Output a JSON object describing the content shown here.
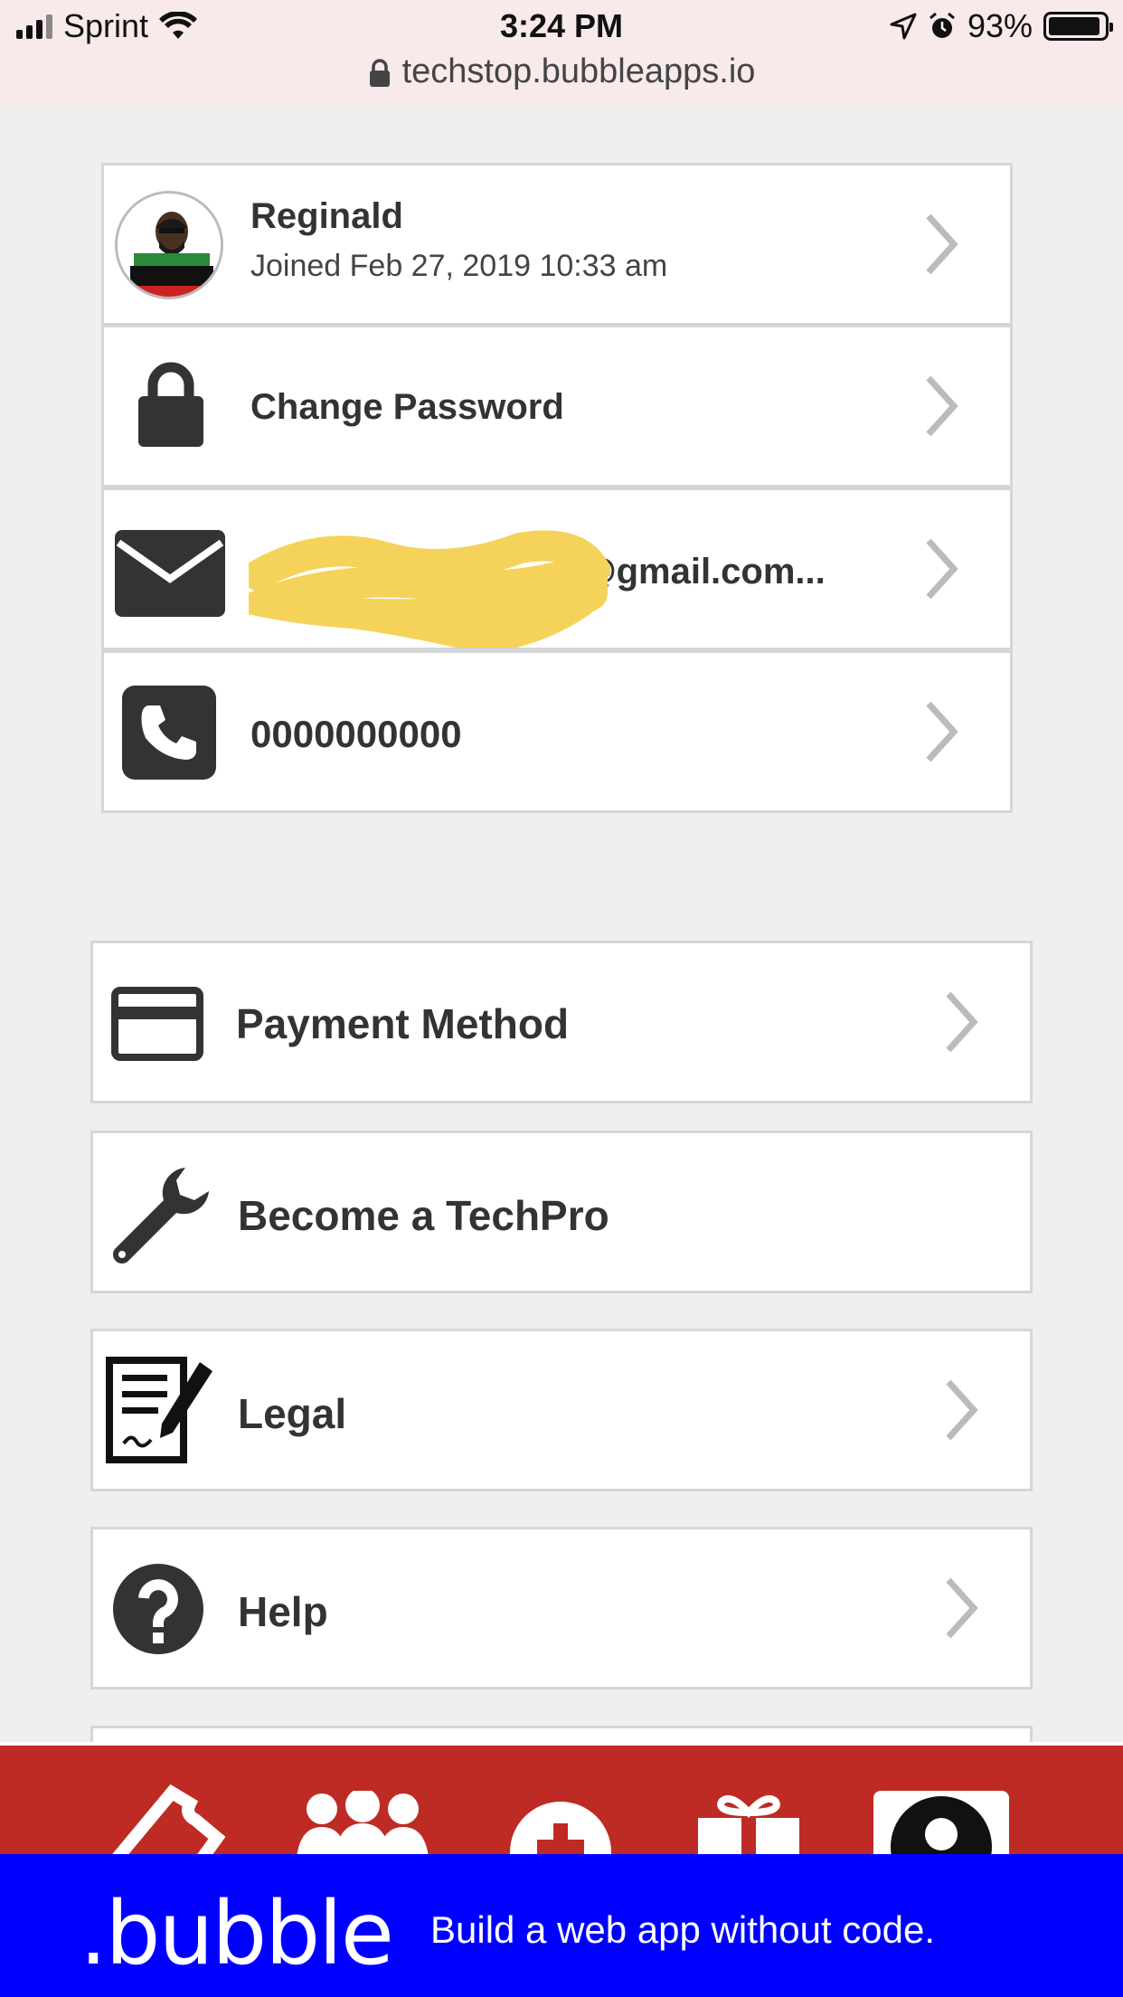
{
  "status": {
    "carrier": "Sprint",
    "time": "3:24 PM",
    "battery": "93%",
    "battery_level": 0.93,
    "url": "techstop.bubbleapps.io"
  },
  "profile": {
    "name": "Reginald",
    "joined": "Joined Feb 27, 2019 10:33 am"
  },
  "account": {
    "change_password": "Change Password",
    "email": "@gmail.com...",
    "phone": "0000000000"
  },
  "menu": {
    "payment": "Payment Method",
    "techpro": "Become a TechPro",
    "legal": "Legal",
    "help": "Help"
  },
  "banner": {
    "logo": ".bubble",
    "tagline": "Build a web app without code."
  },
  "colors": {
    "accent_red": "#be2b24",
    "bubble_blue": "#0000ff",
    "icon_dark": "#333333"
  }
}
